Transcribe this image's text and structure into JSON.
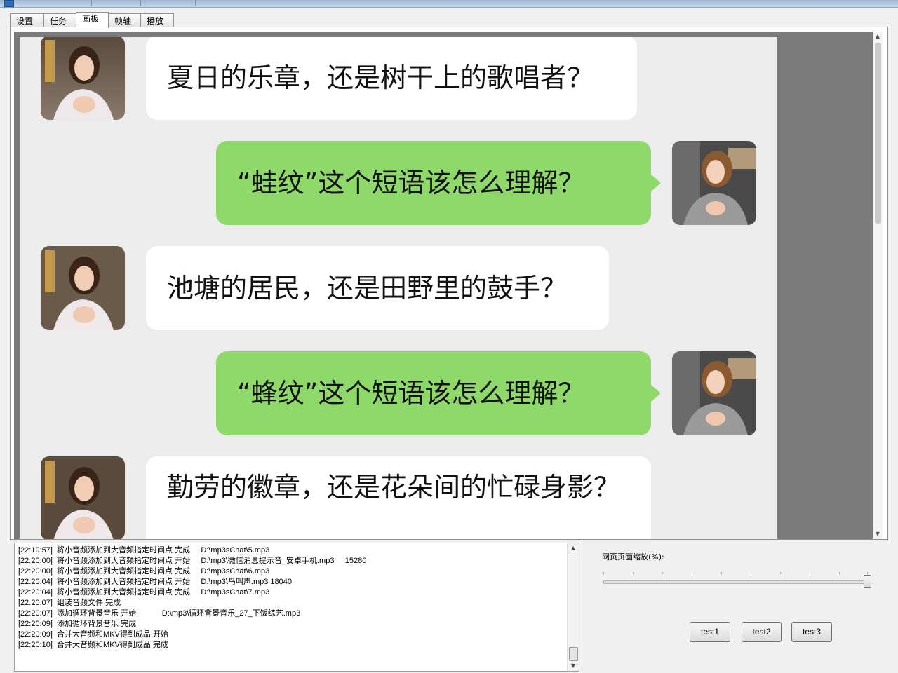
{
  "window": {
    "accent": "#2d6fb8"
  },
  "tabs": [
    {
      "label": "设置",
      "active": false
    },
    {
      "label": "任务",
      "active": false
    },
    {
      "label": "画板",
      "active": true
    },
    {
      "label": "帧轴",
      "active": false
    },
    {
      "label": "播放",
      "active": false
    }
  ],
  "chat": {
    "messages": [
      {
        "side": "left",
        "text": "夏日的乐章，还是树干上的歌唱者？",
        "avatar": "girl-white-dress-avatar"
      },
      {
        "side": "right",
        "text": "“蛙纹”这个短语该怎么理解？",
        "avatar": "girl-gray-top-avatar"
      },
      {
        "side": "left",
        "text": "池塘的居民，还是田野里的鼓手？",
        "avatar": "girl-white-dress-avatar"
      },
      {
        "side": "right",
        "text": "“蜂纹”这个短语该怎么理解？",
        "avatar": "girl-gray-top-avatar"
      },
      {
        "side": "left",
        "text": "勤劳的徽章，还是花朵间的忙碌身影？",
        "avatar": "girl-white-dress-avatar"
      }
    ],
    "colors": {
      "left_bubble": "#ffffff",
      "right_bubble": "#8fd86a",
      "background": "#ececec"
    }
  },
  "log": {
    "lines": [
      "[22:19:57]  将小音频添加到大音频指定时间点 完成     D:\\mp3sChat\\5.mp3",
      "[22:20:00]  将小音频添加到大音频指定时间点 开始     D:\\mp3\\微信消息提示音_安卓手机.mp3     15280",
      "[22:20:00]  将小音频添加到大音频指定时间点 完成     D:\\mp3sChat\\6.mp3",
      "[22:20:04]  将小音频添加到大音频指定时间点 开始     D:\\mp3\\鸟叫声.mp3 18040",
      "[22:20:04]  将小音频添加到大音频指定时间点 完成     D:\\mp3sChat\\7.mp3",
      "[22:20:07]  组装音频文件 完成",
      "[22:20:07]  添加循环背景音乐 开始            D:\\mp3\\循环背景音乐_27_下饭综艺.mp3",
      "[22:20:09]  添加循环背景音乐 完成",
      "[22:20:09]  合并大音频和MKV得到成品 开始",
      "[22:20:10]  合并大音频和MKV得到成品 完成"
    ]
  },
  "controls": {
    "zoom_label": "网页页面缩放(%):",
    "zoom_level_fraction": 1.0,
    "buttons": [
      "test1",
      "test2",
      "test3"
    ]
  }
}
